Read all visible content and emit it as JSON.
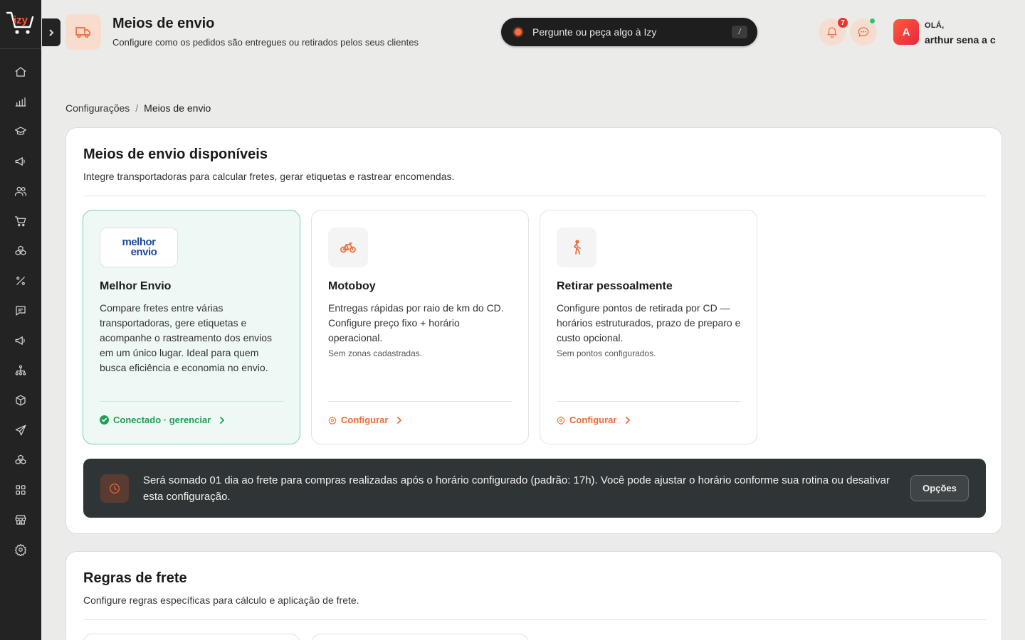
{
  "colors": {
    "accent": "#ef6a35",
    "success": "#1f9d55",
    "sidebar": "#232323"
  },
  "sidebar": {
    "logo_text": "izy",
    "items": [
      {
        "icon": "home-icon"
      },
      {
        "icon": "bar-chart-icon"
      },
      {
        "icon": "graduation-cap-icon"
      },
      {
        "icon": "megaphone-icon"
      },
      {
        "icon": "users-icon"
      },
      {
        "icon": "shopping-cart-icon"
      },
      {
        "icon": "boxes-icon"
      },
      {
        "icon": "percent-icon"
      },
      {
        "icon": "message-square-icon"
      },
      {
        "icon": "megaphone-icon"
      },
      {
        "icon": "network-icon"
      },
      {
        "icon": "package-icon"
      },
      {
        "icon": "send-icon"
      },
      {
        "icon": "boxes-icon"
      },
      {
        "icon": "grid-icon"
      },
      {
        "icon": "store-icon"
      },
      {
        "icon": "gear-icon"
      }
    ]
  },
  "header": {
    "title": "Meios de envio",
    "subtitle": "Configure como os pedidos são entregues ou retirados pelos seus clientes",
    "ai_placeholder": "Pergunte ou peça algo à Izy",
    "ai_shortcut": "/",
    "notification_count": "7",
    "user_initial": "A",
    "greeting": "OLÁ,",
    "user_name": "arthur sena a c"
  },
  "breadcrumb": {
    "parent": "Configurações",
    "separator": "/",
    "current": "Meios de envio"
  },
  "shipping": {
    "title": "Meios de envio disponíveis",
    "description": "Integre transportadoras para calcular fretes, gerar etiquetas e rastrear encomendas.",
    "cards": [
      {
        "logo_line1": "melhor",
        "logo_line2": "envio",
        "title": "Melhor Envio",
        "description": "Compare fretes entre várias transportadoras, gere etiquetas e acompanhe o rastreamento dos envios em um único lugar. Ideal para quem busca eficiência e economia no envio.",
        "action": "Conectado · gerenciar"
      },
      {
        "title": "Motoboy",
        "description": "Entregas rápidas por raio de km do CD. Configure preço fixo + horário operacional.",
        "note": "Sem zonas cadastradas.",
        "action": "Configurar"
      },
      {
        "title": "Retirar pessoalmente",
        "description": "Configure pontos de retirada por CD — horários estruturados, prazo de preparo e custo opcional.",
        "note": "Sem pontos configurados.",
        "action": "Configurar"
      }
    ],
    "info_text": "Será somado 01 dia ao frete para compras realizadas após o horário configurado (padrão: 17h). Você pode ajustar o horário conforme sua rotina ou desativar esta configuração.",
    "info_button": "Opções"
  },
  "rules": {
    "title": "Regras de frete",
    "description": "Configure regras específicas para cálculo e aplicação de frete."
  }
}
